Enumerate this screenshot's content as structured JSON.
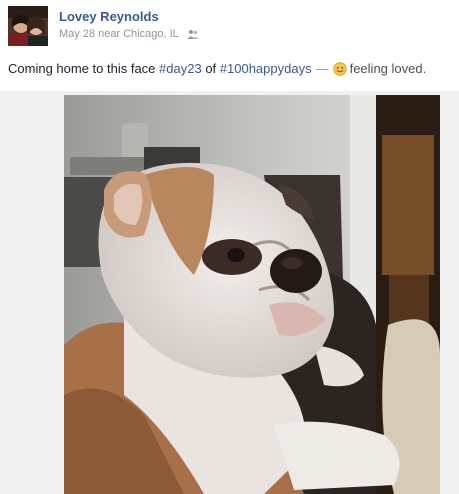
{
  "post": {
    "author": "Lovey Reynolds",
    "date": "May 28",
    "location_prefix": "near",
    "location": "Chicago, IL",
    "audience_icon": "friends-icon",
    "status": {
      "text_before": "Coming home to this face",
      "hashtag1": "#day23",
      "of_word": "of",
      "hashtag2": "#100happydays",
      "dash": "—",
      "feeling_icon": "smiling-emoji-icon",
      "feeling": "feeling loved."
    },
    "photo_subject": "bulldog-photo"
  },
  "colors": {
    "link": "#3b5998",
    "meta": "#90949c",
    "text": "#1d2129",
    "photo_bg": "#f0f0f0"
  }
}
